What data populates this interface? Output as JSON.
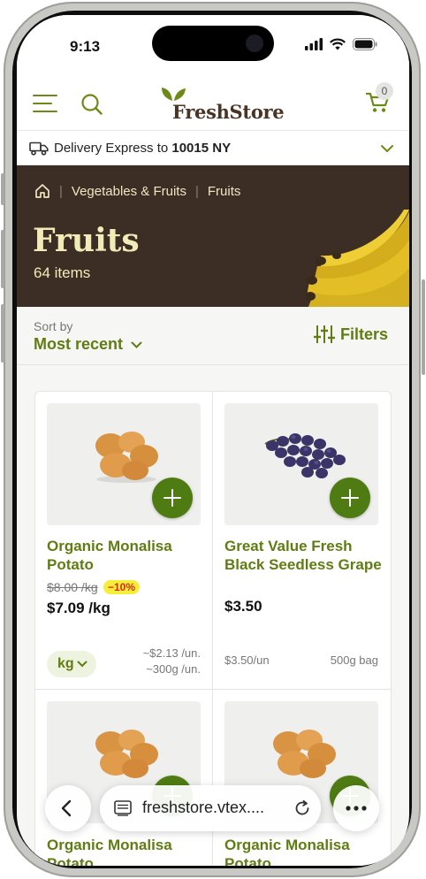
{
  "status_bar": {
    "time": "9:13"
  },
  "header": {
    "logo": "FreshStore",
    "cart_count": "0"
  },
  "delivery": {
    "prefix": "Delivery Express to ",
    "location": "10015 NY"
  },
  "hero": {
    "breadcrumb": [
      "Vegetables & Fruits",
      "Fruits"
    ],
    "title": "Fruits",
    "count": "64 items"
  },
  "sort": {
    "label": "Sort by",
    "value": "Most recent",
    "filters_label": "Filters"
  },
  "products": [
    {
      "name": "Organic Monalisa Potato",
      "old_price": "$8.00 /kg",
      "discount": "−10%",
      "price": "$7.09 /kg",
      "unit_selector": "kg",
      "unit_price_1": "~$2.13 /un.",
      "unit_price_2": "~300g /un."
    },
    {
      "name": "Great Value Fresh Black Seedless Grape",
      "price": "$3.50",
      "unit_price": "$3.50/un",
      "size": "500g bag"
    },
    {
      "name": "Organic Monalisa Potato"
    },
    {
      "name": "Organic Monalisa Potato"
    }
  ],
  "browser": {
    "url": "freshstore.vtex...."
  },
  "colors": {
    "brand_green": "#5f7d12",
    "hero_bg": "#3c2e24",
    "logo_brown": "#4a3426",
    "discount_yellow": "#f6ee38"
  }
}
